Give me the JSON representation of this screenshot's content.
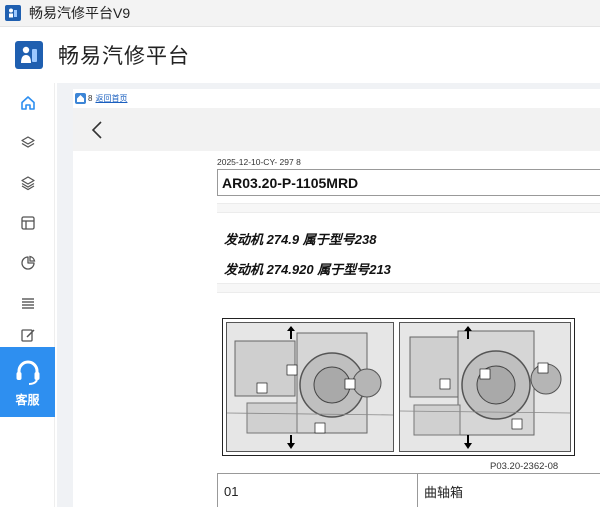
{
  "window": {
    "title": "畅易汽修平台V9"
  },
  "header": {
    "brand": "畅易汽修平台"
  },
  "sidebar": {
    "items": [
      {
        "icon": "home-icon"
      },
      {
        "icon": "layers-icon"
      },
      {
        "icon": "layers-alt-icon"
      },
      {
        "icon": "layout-icon"
      },
      {
        "icon": "pie-chart-icon"
      },
      {
        "icon": "list-icon"
      },
      {
        "icon": "edit-icon"
      }
    ],
    "service_label": "客服"
  },
  "breadcrumb": {
    "number": "8",
    "link_text": "返回首页"
  },
  "document": {
    "doc_id": "2025-12-10-CY- 297 8",
    "doc_number": "AR03.20-P-1105MRD",
    "engines": [
      "发动机  274.9 属于型号238",
      "发动机  274.920 属于型号213"
    ],
    "figure_code": "P03.20-2362-08",
    "table": [
      {
        "code": "01",
        "name": "曲轴箱"
      }
    ]
  },
  "colors": {
    "accent": "#2e8ff0",
    "brand_blue": "#1f5fb0"
  }
}
